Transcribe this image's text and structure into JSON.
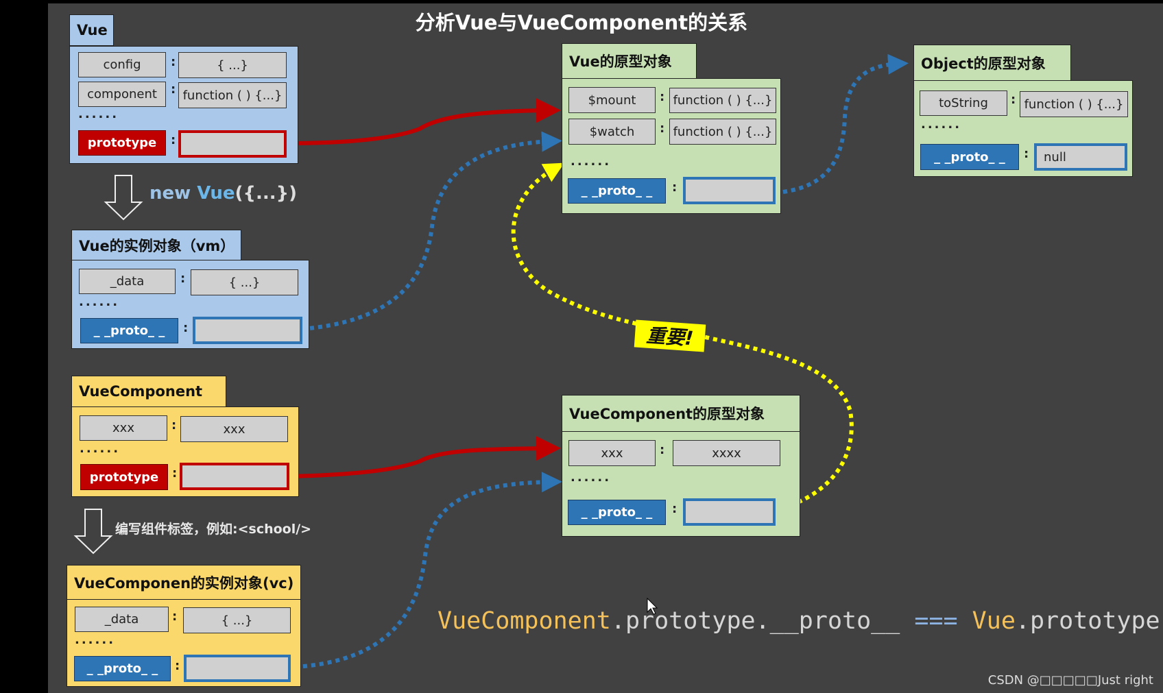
{
  "title": "分析Vue与VueComponent的关系",
  "vue": {
    "label": "Vue",
    "rows": [
      {
        "key": "config",
        "value": "{ ...}"
      },
      {
        "key": "component",
        "value": "function ( ) {...}"
      }
    ],
    "ellipsis": "......",
    "prototype_key": "prototype",
    "prototype_value": ""
  },
  "new_vue_note": {
    "prefix": "new ",
    "vue": "Vue",
    "suffix": "({...})"
  },
  "vm": {
    "label": "Vue的实例对象（vm）",
    "rows": [
      {
        "key": "_data",
        "value": "{ ...}"
      }
    ],
    "ellipsis": "......",
    "proto_key": "_ _proto_ _",
    "proto_value": ""
  },
  "vue_component": {
    "label": "VueComponent",
    "rows": [
      {
        "key": "xxx",
        "value": "xxx"
      }
    ],
    "ellipsis": "......",
    "prototype_key": "prototype",
    "prototype_value": ""
  },
  "component_tag_note": "编写组件标签，例如:<school/>",
  "vc": {
    "label": "VueComponen的实例对象(vc)",
    "rows": [
      {
        "key": "_data",
        "value": "{ ...}"
      }
    ],
    "ellipsis": "......",
    "proto_key": "_ _proto_ _",
    "proto_value": ""
  },
  "vue_prototype_obj": {
    "label": "Vue的原型对象",
    "rows": [
      {
        "key": "$mount",
        "value": "function ( ) {...}"
      },
      {
        "key": "$watch",
        "value": "function ( ) {...}"
      }
    ],
    "ellipsis": "......",
    "proto_key": "_ _proto_ _",
    "proto_value": ""
  },
  "object_prototype_obj": {
    "label": "Object的原型对象",
    "rows": [
      {
        "key": "toString",
        "value": "function ( ) {...}"
      }
    ],
    "ellipsis": "......",
    "proto_key": "_ _proto_ _",
    "proto_value": "null"
  },
  "vc_prototype_obj": {
    "label": "VueComponent的原型对象",
    "rows": [
      {
        "key": "xxx",
        "value": "xxxx"
      }
    ],
    "ellipsis": "......",
    "proto_key": "_ _proto_ _",
    "proto_value": ""
  },
  "important_label": "重要!",
  "formula": {
    "part1": "VueComponent",
    "part2": ".prototype.__proto__ ",
    "part3": "===",
    "part4": " Vue",
    "part5": ".prototype"
  },
  "colon": ":",
  "watermark": "CSDN @□□□□□Just right",
  "colors": {
    "background": "#414141",
    "vue_panel": "#a9c8ea",
    "prototype_panel": "#c6e0b4",
    "component_panel": "#fbd86b",
    "red_arrow": "#c00000",
    "blue_arrow": "#2e75b6",
    "yellow_arrow": "#ffff00"
  }
}
